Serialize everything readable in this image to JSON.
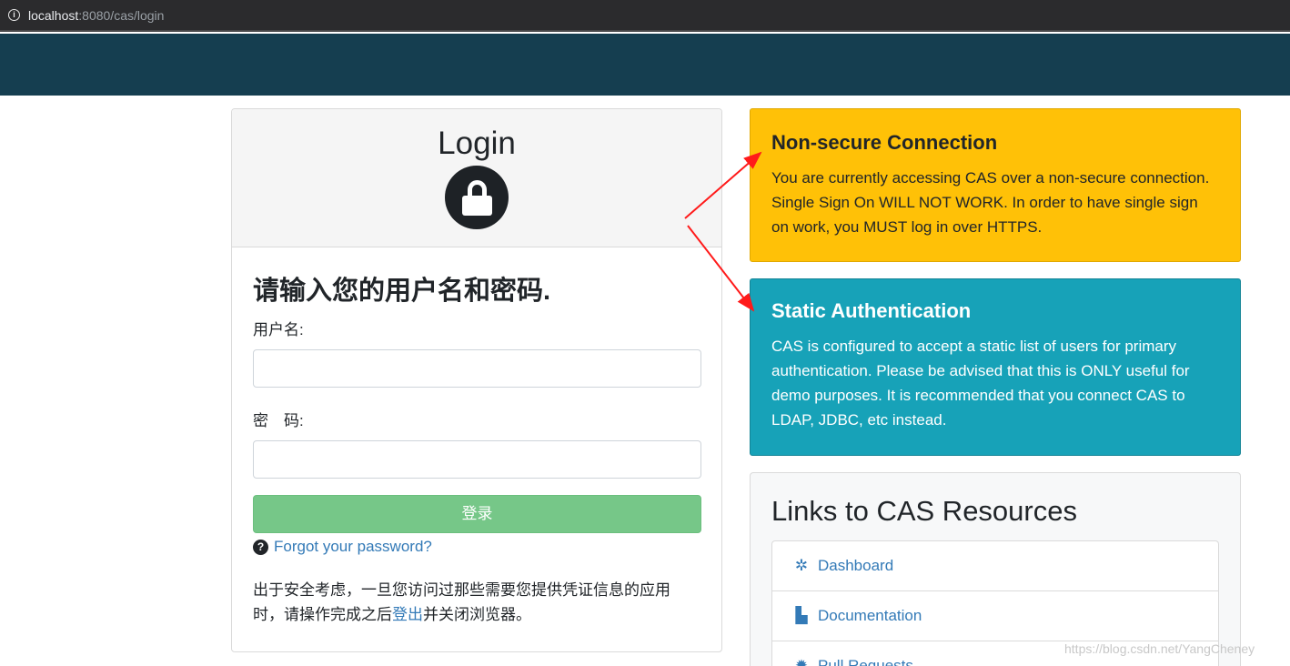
{
  "browser": {
    "url_host": "localhost",
    "url_path": ":8080/cas/login"
  },
  "login": {
    "title": "Login",
    "prompt": "请输入您的用户名和密码.",
    "username_label": "用户名:",
    "password_label": "密　码:",
    "submit_label": "登录",
    "forgot_label": "Forgot your password?",
    "note_before": "出于安全考虑，一旦您访问过那些需要您提供凭证信息的应用时，请操作完成之后",
    "note_link": "登出",
    "note_after": "并关闭浏览器。"
  },
  "warning": {
    "title": "Non-secure Connection",
    "text": "You are currently accessing CAS over a non-secure connection. Single Sign On WILL NOT WORK. In order to have single sign on work, you MUST log in over HTTPS.",
    "color": "#ffc107"
  },
  "info": {
    "title": "Static Authentication",
    "text": "CAS is configured to accept a static list of users for primary authentication. Please be advised that this is ONLY useful for demo purposes. It is recommended that you connect CAS to LDAP, JDBC, etc instead.",
    "color": "#17a2b8"
  },
  "links": {
    "title": "Links to CAS Resources",
    "items": [
      {
        "label": "Dashboard",
        "icon": "cogs-icon"
      },
      {
        "label": "Documentation",
        "icon": "file-icon"
      },
      {
        "label": "Pull Requests",
        "icon": "bug-icon"
      }
    ]
  },
  "watermark": "https://blog.csdn.net/YangCheney"
}
